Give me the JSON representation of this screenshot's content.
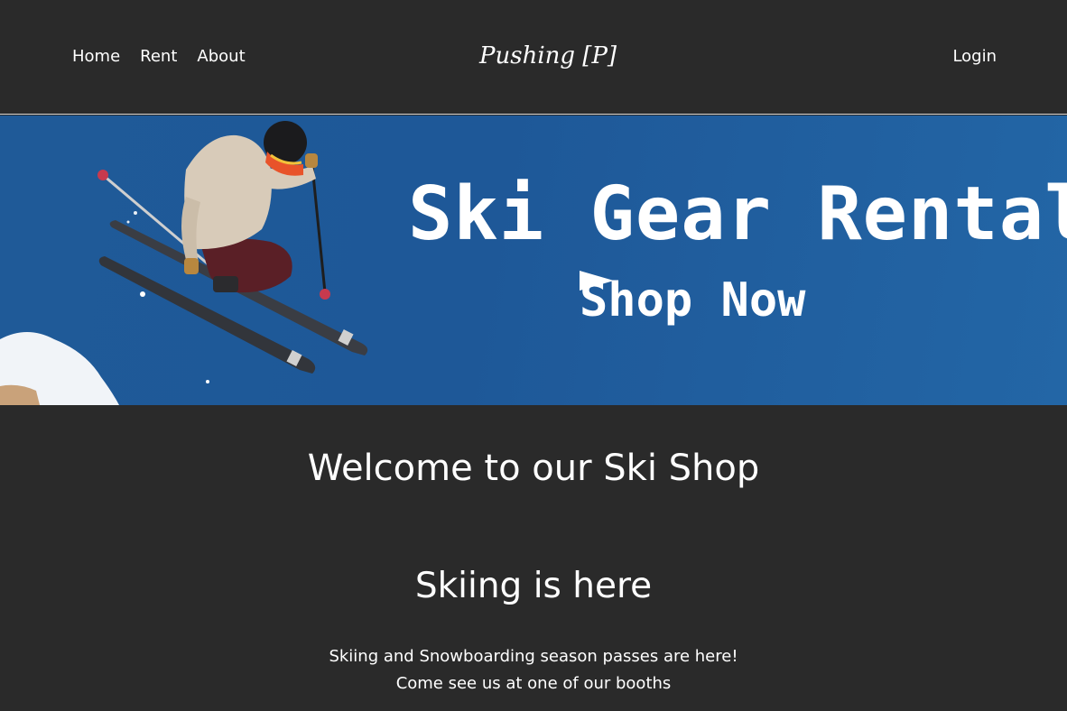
{
  "nav": {
    "links": [
      "Home",
      "Rent",
      "About"
    ],
    "brand": "Pushing [P]",
    "login": "Login"
  },
  "banner": {
    "title": "Ski Gear Rental",
    "cta_label": "Shop Now",
    "cta_arrow": "►",
    "background_color": "#1f5a98"
  },
  "main": {
    "welcome": "Welcome to our Ski Shop",
    "subhead": "Skiing is here",
    "lines": [
      "Skiing and Snowboarding season passes are here!",
      "Come see us at one of our booths"
    ]
  },
  "colors": {
    "page_background": "#2a2a2a",
    "text": "#ffffff",
    "nav_border": "#d8d8d8"
  }
}
